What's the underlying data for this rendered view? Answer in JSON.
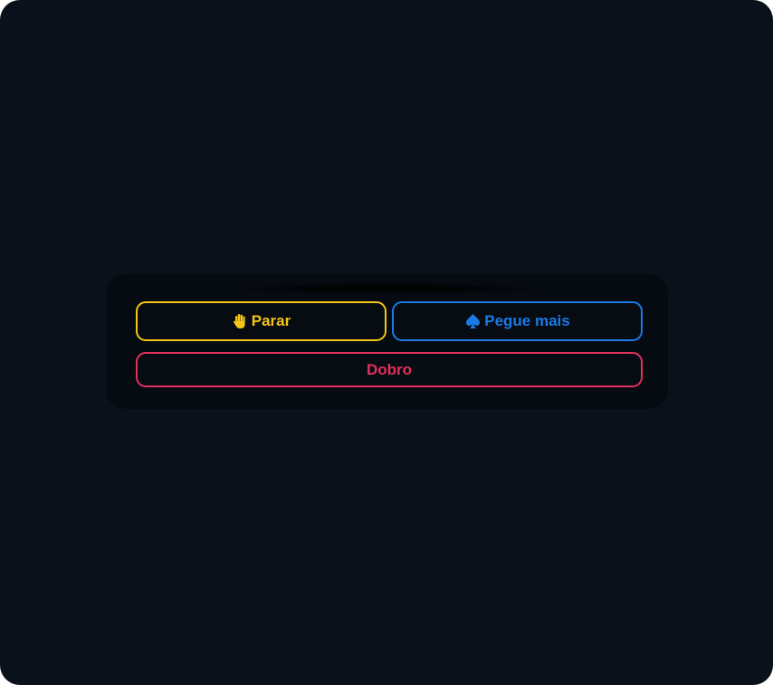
{
  "actions": {
    "stand": {
      "label": "Parar",
      "icon": "hand-icon",
      "color": "#f5c518"
    },
    "hit": {
      "label": "Pegue mais",
      "icon": "spade-icon",
      "color": "#1b7ae6"
    },
    "double": {
      "label": "Dobro",
      "color": "#e3305c"
    }
  },
  "theme": {
    "background": "#0b111a",
    "panel": "#060a11"
  }
}
